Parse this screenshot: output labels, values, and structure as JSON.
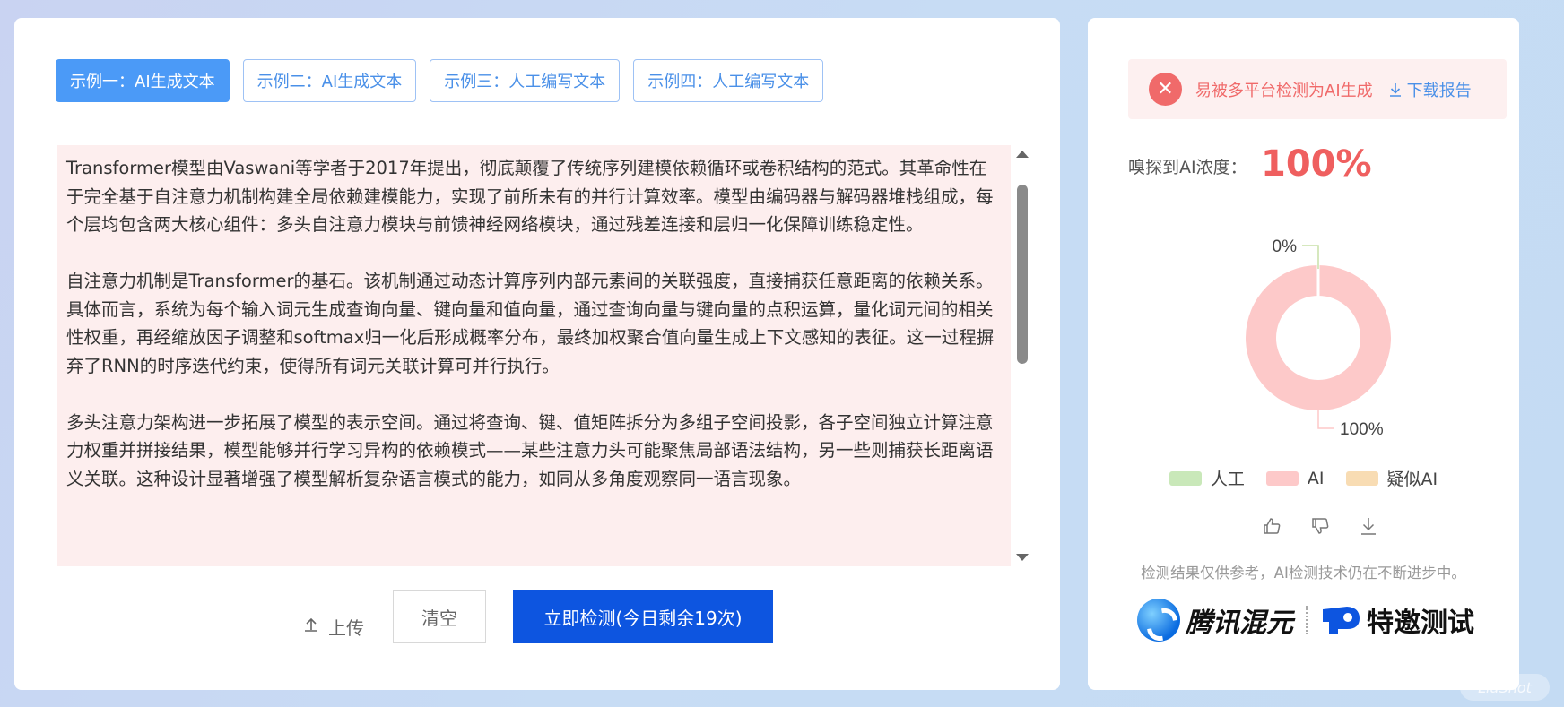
{
  "tabs": [
    {
      "label": "示例一：AI生成文本",
      "active": true
    },
    {
      "label": "示例二：AI生成文本",
      "active": false
    },
    {
      "label": "示例三：人工编写文本",
      "active": false
    },
    {
      "label": "示例四：人工编写文本",
      "active": false
    }
  ],
  "text": {
    "paragraphs": [
      "Transformer模型由Vaswani等学者于2017年提出，彻底颠覆了传统序列建模依赖循环或卷积结构的范式。其革命性在于完全基于自注意力机制构建全局依赖建模能力，实现了前所未有的并行计算效率。模型由编码器与解码器堆栈组成，每个层均包含两大核心组件：多头自注意力模块与前馈神经网络模块，通过残差连接和层归一化保障训练稳定性。",
      "自注意力机制是Transformer的基石。该机制通过动态计算序列内部元素间的关联强度，直接捕获任意距离的依赖关系。具体而言，系统为每个输入词元生成查询向量、键向量和值向量，通过查询向量与键向量的点积运算，量化词元间的相关性权重，再经缩放因子调整和softmax归一化后形成概率分布，最终加权聚合值向量生成上下文感知的表征。这一过程摒弃了RNN的时序迭代约束，使得所有词元关联计算可并行执行。",
      "多头注意力架构进一步拓展了模型的表示空间。通过将查询、键、值矩阵拆分为多组子空间投影，各子空间独立计算注意力权重并拼接结果，模型能够并行学习异构的依赖模式——某些注意力头可能聚焦局部语法结构，另一些则捕获长距离语义关联。这种设计显著增强了模型解析复杂语言模式的能力，如同从多角度观察同一语言现象。"
    ]
  },
  "actions": {
    "upload_label": "上传",
    "clear_label": "清空",
    "detect_label": "立即检测(今日剩余19次)"
  },
  "result": {
    "alert_text": "易被多平台检测为AI生成",
    "download_label": "下载报告",
    "concentration_label": "嗅探到AI浓度：",
    "concentration_value": "100%",
    "disclaimer": "检测结果仅供参考，AI检测技术仍在不断进步中。"
  },
  "chart_data": {
    "type": "pie",
    "categories": [
      "人工",
      "AI",
      "疑似AI"
    ],
    "values": [
      0,
      100,
      0
    ],
    "colors": [
      "#c9e8b9",
      "#fdc9c9",
      "#f8dcb3"
    ],
    "labels": [
      "0%",
      "100%"
    ],
    "legend_position": "bottom"
  },
  "brand": {
    "name": "腾讯混元",
    "invite": "特邀测试"
  },
  "watermark": "LiuShot"
}
